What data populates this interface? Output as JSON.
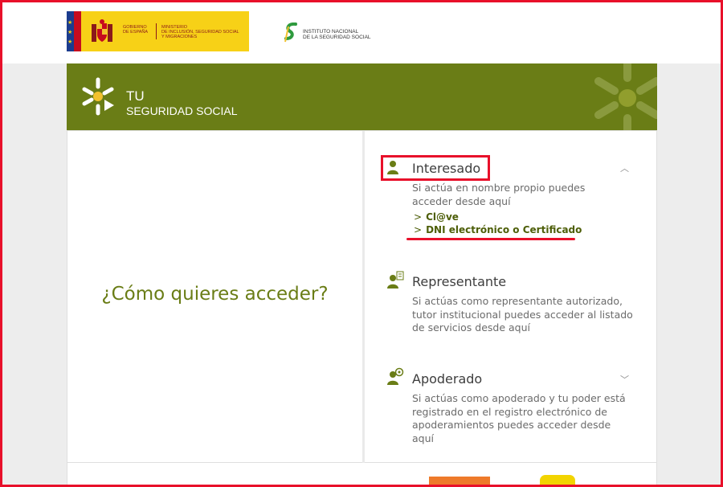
{
  "header": {
    "gov_logo": {
      "line1": "GOBIERNO",
      "line2": "DE ESPAÑA",
      "ministry1": "MINISTERIO",
      "ministry2": "DE INCLUSIÓN, SEGURIDAD SOCIAL",
      "ministry3": "Y MIGRACIONES"
    },
    "inss_logo": {
      "line1": "INSTITUTO NACIONAL",
      "line2": "DE LA SEGURIDAD SOCIAL"
    }
  },
  "banner": {
    "brand_line1": "TU",
    "brand_line2": "SEGURIDAD SOCIAL",
    "color": "#6a7d16"
  },
  "main": {
    "question": "¿Cómo quieres acceder?"
  },
  "options": {
    "interesado": {
      "title": "Interesado",
      "description": "Si actúa en nombre propio puedes acceder desde aquí",
      "expanded": true,
      "links": [
        {
          "label": "Cl@ve"
        },
        {
          "label": "DNI electrónico o Certificado"
        }
      ]
    },
    "representante": {
      "title": "Representante",
      "description": "Si actúas como representante autorizado, tutor institucional puedes acceder al listado de servicios desde aquí"
    },
    "apoderado": {
      "title": "Apoderado",
      "description": "Si actúas como apoderado y tu poder está registrado en el registro electrónico de apoderamientos puedes acceder desde aquí",
      "expanded": false
    }
  },
  "colors": {
    "accent": "#6a7d16",
    "highlight": "#e8102a"
  }
}
